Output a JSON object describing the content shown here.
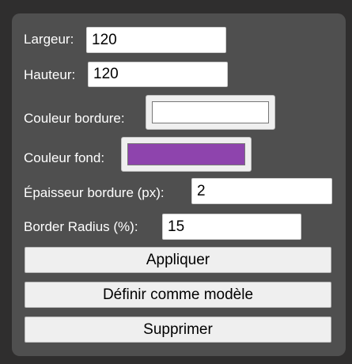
{
  "form": {
    "width_label": "Largeur:",
    "width_value": "120",
    "height_label": "Hauteur:",
    "height_value": "120",
    "border_color_label": "Couleur bordure:",
    "border_color_value": "#ffffff",
    "fill_color_label": "Couleur fond:",
    "fill_color_value": "#8e44ad",
    "border_thickness_label": "Épaisseur bordure (px):",
    "border_thickness_value": "2",
    "border_radius_label": "Border Radius (%):",
    "border_radius_value": "15"
  },
  "buttons": {
    "apply_label": "Appliquer",
    "set_template_label": "Définir comme modèle",
    "delete_label": "Supprimer"
  }
}
